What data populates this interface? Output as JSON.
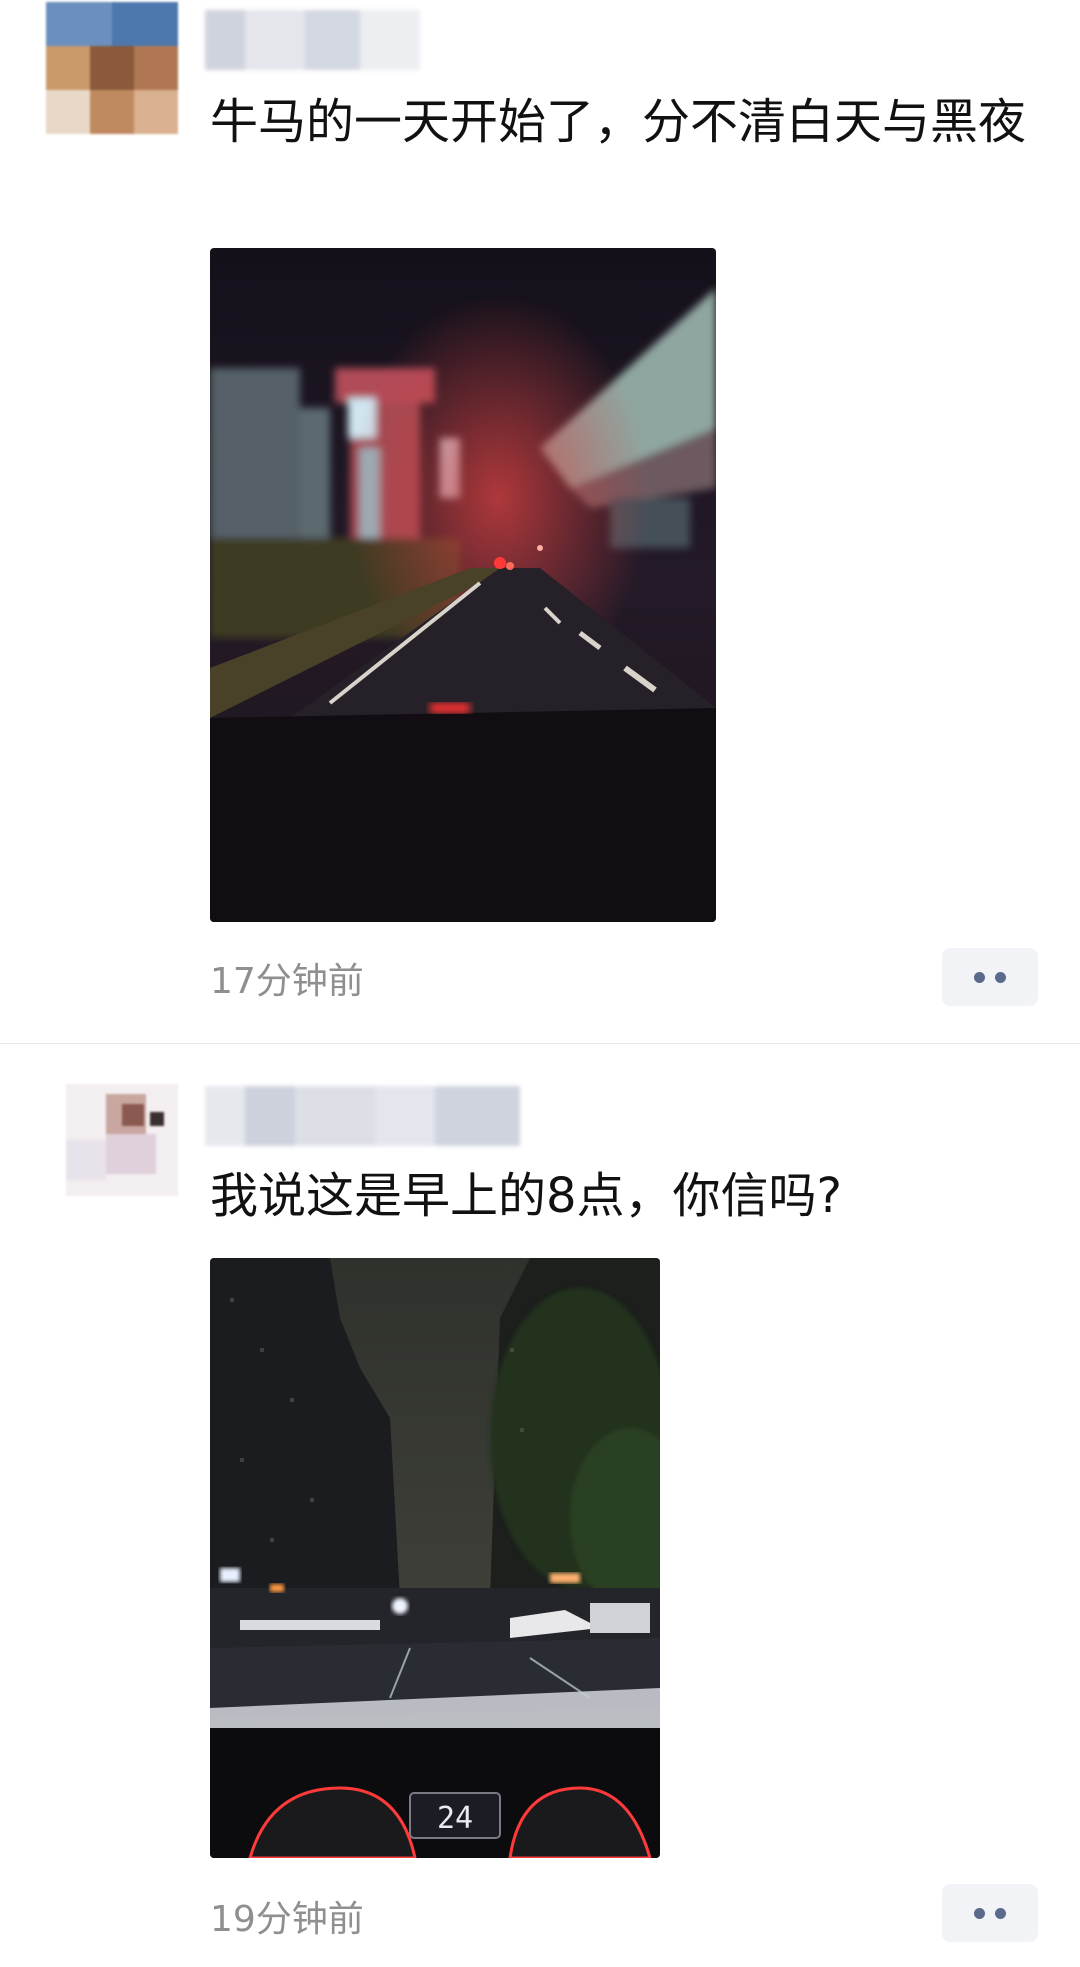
{
  "feed": {
    "posts": [
      {
        "author_name": "",
        "text": "牛马的一天开始了，分不清白天与黑夜",
        "time": "17分钟前",
        "more_icon": "more-dots-icon"
      },
      {
        "author_name": "",
        "text": "我说这是早上的8点，你信吗?",
        "time": "19分钟前",
        "more_icon": "more-dots-icon"
      }
    ]
  },
  "photo2": {
    "speed_readout": "24"
  },
  "colors": {
    "time": "#8f8f8f",
    "more_dots": "#5a6a8c",
    "more_bg": "#f2f3f6"
  }
}
